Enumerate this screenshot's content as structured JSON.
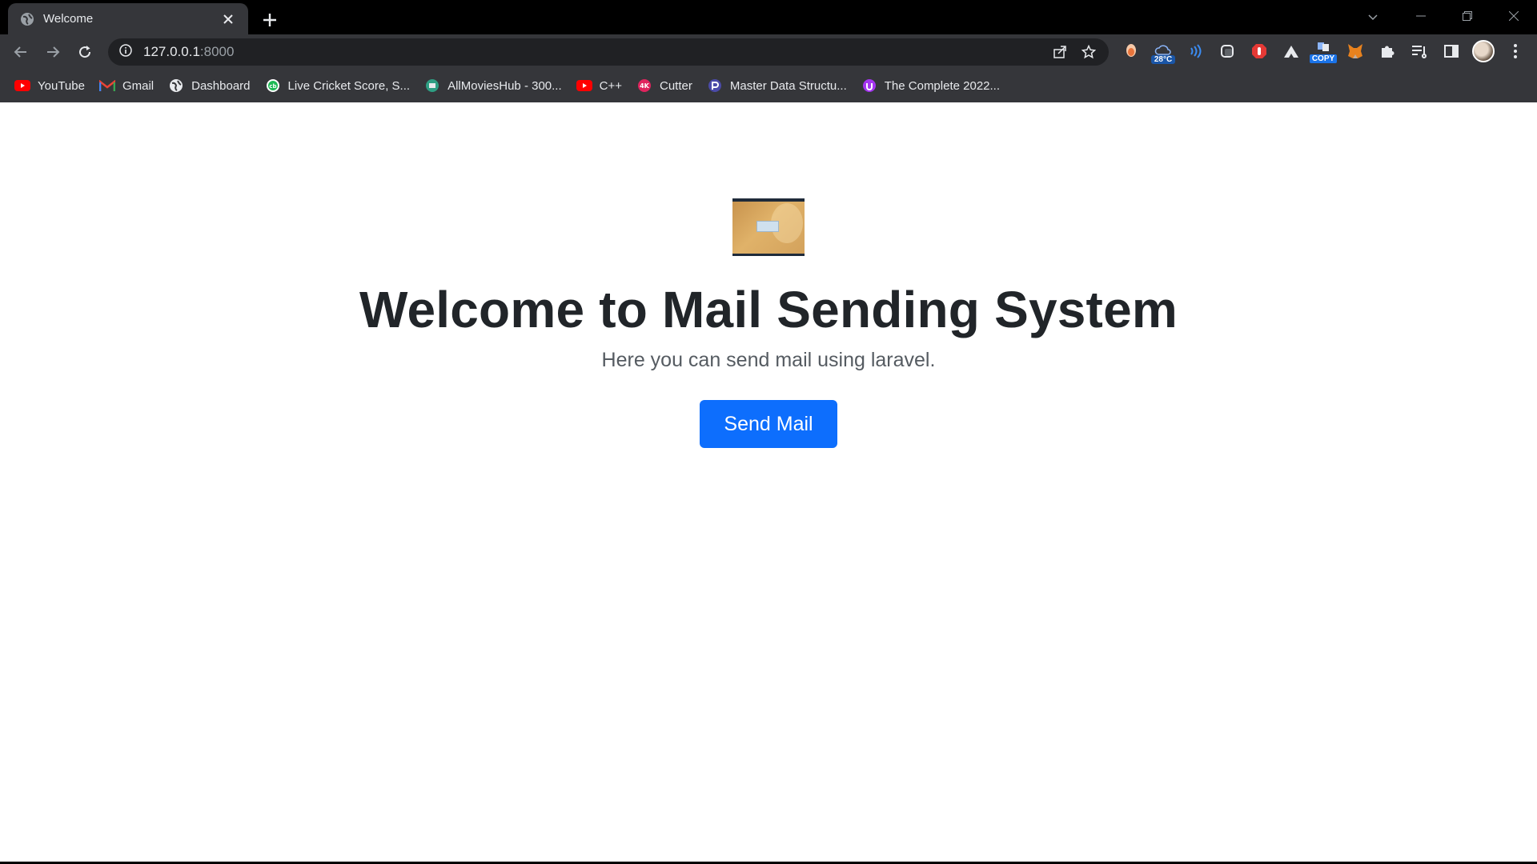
{
  "browser": {
    "tab": {
      "title": "Welcome"
    },
    "address": {
      "host": "127.0.0.1",
      "port": ":8000"
    },
    "extensions": {
      "weather_temp": "28°C",
      "copy_label": "COPY"
    },
    "bookmarks": [
      {
        "label": "YouTube",
        "icon": "youtube-icon"
      },
      {
        "label": "Gmail",
        "icon": "gmail-icon"
      },
      {
        "label": "Dashboard",
        "icon": "globe-icon"
      },
      {
        "label": "Live Cricket Score, S...",
        "icon": "cricbuzz-icon"
      },
      {
        "label": "AllMoviesHub - 300...",
        "icon": "movies-icon"
      },
      {
        "label": "C++",
        "icon": "youtube-icon"
      },
      {
        "label": "Cutter",
        "icon": "4k-icon"
      },
      {
        "label": "Master Data Structu...",
        "icon": "course-icon"
      },
      {
        "label": "The Complete 2022...",
        "icon": "udemy-icon"
      }
    ]
  },
  "page": {
    "title": "Welcome to Mail Sending System",
    "subtitle": "Here you can send mail using laravel.",
    "send_button": "Send Mail"
  },
  "colors": {
    "primary_button": "#0d6efd",
    "heading": "#212529",
    "chrome_bg": "#35363a",
    "tabstrip_bg": "#000000"
  }
}
